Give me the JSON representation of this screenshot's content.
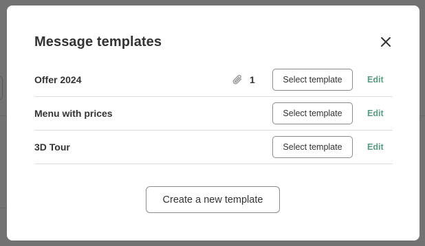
{
  "modal": {
    "title": "Message templates",
    "close_icon": "close-icon"
  },
  "templates": [
    {
      "name": "Offer 2024",
      "attachment_count": "1",
      "has_attachment": true,
      "select_label": "Select template",
      "edit_label": "Edit"
    },
    {
      "name": "Menu with prices",
      "has_attachment": false,
      "select_label": "Select template",
      "edit_label": "Edit"
    },
    {
      "name": "3D Tour",
      "has_attachment": false,
      "select_label": "Select template",
      "edit_label": "Edit"
    }
  ],
  "actions": {
    "create_label": "Create a new template"
  },
  "icons": {
    "attachment": "paperclip-icon"
  },
  "colors": {
    "overlay": "#727272",
    "modal_bg": "#ffffff",
    "text": "#333333",
    "edit_link": "#5a9a80",
    "divider": "#dcdcdc",
    "button_border": "#8a8a8a"
  }
}
